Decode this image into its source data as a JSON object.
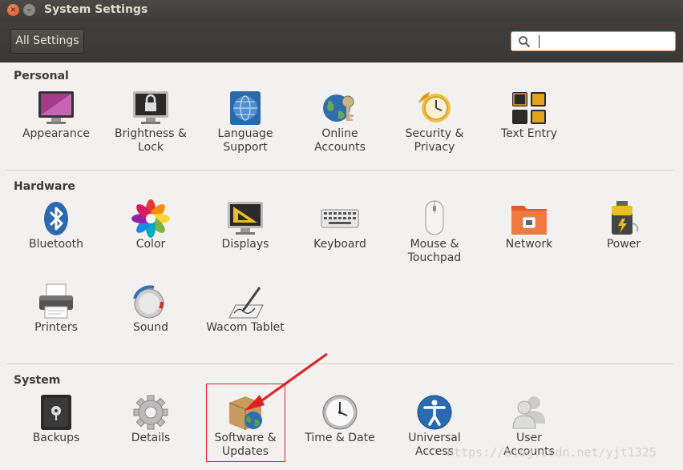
{
  "window": {
    "title": "System Settings"
  },
  "toolbar": {
    "all_settings_label": "All Settings",
    "search_value": ""
  },
  "sections": {
    "personal": {
      "title": "Personal",
      "items": [
        "Appearance",
        "Brightness &\nLock",
        "Language\nSupport",
        "Online\nAccounts",
        "Security &\nPrivacy",
        "Text Entry"
      ]
    },
    "hardware": {
      "title": "Hardware",
      "items": [
        "Bluetooth",
        "Color",
        "Displays",
        "Keyboard",
        "Mouse &\nTouchpad",
        "Network",
        "Power",
        "Printers",
        "Sound",
        "Wacom Tablet"
      ]
    },
    "system": {
      "title": "System",
      "items": [
        "Backups",
        "Details",
        "Software &\nUpdates",
        "Time & Date",
        "Universal\nAccess",
        "User\nAccounts"
      ]
    }
  },
  "watermark": "https://blog.csdn.net/yjt1325",
  "colors": {
    "accent_orange": "#e98a5d",
    "annotation_red": "#e02020",
    "titlebar": "#3d3c38"
  }
}
